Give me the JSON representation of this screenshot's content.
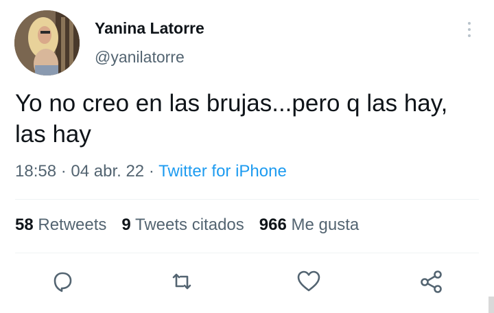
{
  "tweet": {
    "author": {
      "display_name": "Yanina Latorre",
      "handle": "@yanilatorre",
      "avatar_icon": "profile-photo"
    },
    "text": "Yo no creo en las brujas...pero q las hay, las hay",
    "time": "18:58",
    "date": "04 abr. 22",
    "source": "Twitter for iPhone",
    "separator": " · "
  },
  "stats": {
    "retweets": {
      "count": "58",
      "label": "Retweets"
    },
    "quotes": {
      "count": "9",
      "label": "Tweets citados"
    },
    "likes": {
      "count": "966",
      "label": "Me gusta"
    }
  },
  "actions": [
    {
      "icon": "reply-icon"
    },
    {
      "icon": "retweet-icon"
    },
    {
      "icon": "like-icon"
    },
    {
      "icon": "share-icon"
    }
  ],
  "colors": {
    "text": "#0f1419",
    "secondary": "#536471",
    "link": "#1d9bf0",
    "divider": "#eff3f4"
  }
}
